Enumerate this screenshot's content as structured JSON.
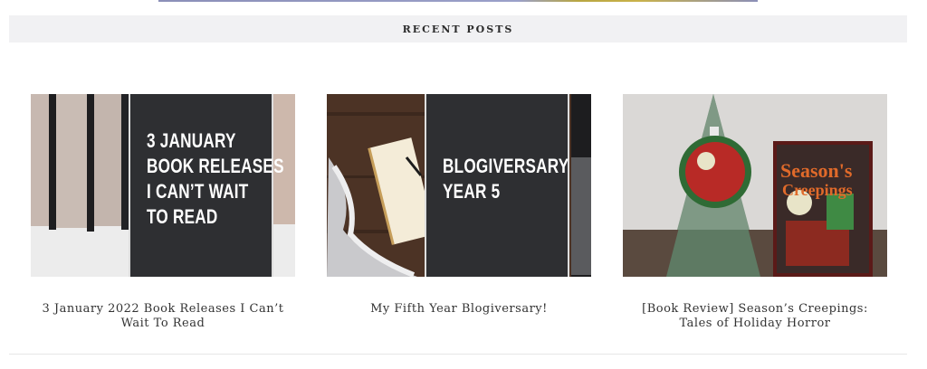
{
  "section": {
    "heading": "RECENT POSTS"
  },
  "posts": [
    {
      "title": "3 January 2022 Book Releases I Can’t Wait To Read",
      "image_text": "3 JANUARY\nBOOK RELEASES\nI CAN’T WAIT\nTO READ"
    },
    {
      "title": "My Fifth Year Blogiversary!",
      "image_text": "BLOGIVERSARY\nYEAR 5"
    },
    {
      "title": "[Book Review] Season’s Creepings: Tales of Holiday Horror",
      "image_text": "Season's Creepings"
    }
  ]
}
